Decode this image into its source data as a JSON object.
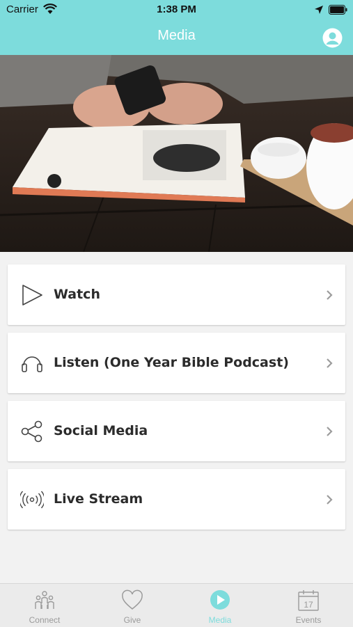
{
  "status": {
    "carrier": "Carrier",
    "time": "1:38 PM"
  },
  "header": {
    "title": "Media",
    "profile_icon": "profile-icon"
  },
  "hero": {
    "description_icon": "hero-photo"
  },
  "menu": {
    "items": [
      {
        "label": "Watch",
        "icon": "play-icon"
      },
      {
        "label": "Listen (One Year Bible Podcast)",
        "icon": "headphones-icon"
      },
      {
        "label": "Social Media",
        "icon": "share-icon"
      },
      {
        "label": "Live Stream",
        "icon": "broadcast-icon"
      }
    ]
  },
  "tabs": [
    {
      "label": "Connect",
      "icon": "people-icon",
      "active": false
    },
    {
      "label": "Give",
      "icon": "heart-icon",
      "active": false
    },
    {
      "label": "Media",
      "icon": "play-circle-icon",
      "active": true
    },
    {
      "label": "Events",
      "icon": "calendar-icon",
      "active": false,
      "calendar_day": "17"
    }
  ],
  "colors": {
    "accent": "#7ddcdc",
    "tab_inactive": "#9a9a9a",
    "background": "#f2f2f2"
  }
}
